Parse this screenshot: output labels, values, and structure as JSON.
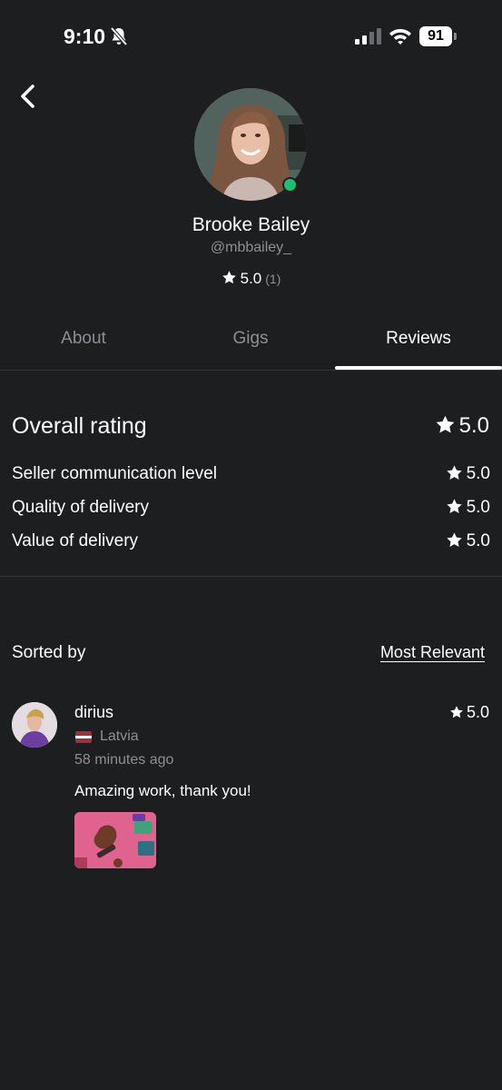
{
  "status_bar": {
    "time": "9:10",
    "battery": "91",
    "icons": [
      "bell-slash-icon",
      "signal-icon",
      "wifi-icon",
      "battery-icon"
    ]
  },
  "header": {
    "back_icon": "chevron-left-icon"
  },
  "profile": {
    "name": "Brooke Bailey",
    "handle": "@mbbailey_",
    "rating": "5.0",
    "rating_count": "(1)",
    "online": true,
    "online_color": "#1dbf73"
  },
  "tabs": [
    {
      "label": "About",
      "active": false
    },
    {
      "label": "Gigs",
      "active": false
    },
    {
      "label": "Reviews",
      "active": true
    }
  ],
  "ratings": {
    "overall_label": "Overall rating",
    "overall_value": "5.0",
    "items": [
      {
        "label": "Seller communication level",
        "value": "5.0"
      },
      {
        "label": "Quality of delivery",
        "value": "5.0"
      },
      {
        "label": "Value of delivery",
        "value": "5.0"
      }
    ]
  },
  "sort": {
    "label": "Sorted by",
    "value": "Most Relevant"
  },
  "reviews": [
    {
      "name": "dirius",
      "country": "Latvia",
      "flag_icon": "latvia-flag-icon",
      "time": "58 minutes ago",
      "rating": "5.0",
      "text": "Amazing work, thank you!"
    }
  ],
  "colors": {
    "background": "#1d1e20",
    "muted_text": "#8e8f94",
    "divider": "#34363a"
  }
}
